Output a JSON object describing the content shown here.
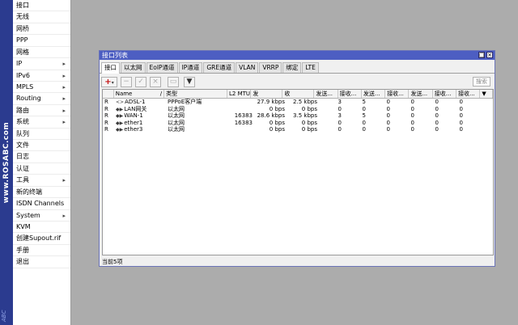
{
  "brand": {
    "text": "www.ROSABC.com",
    "sub": "ABC"
  },
  "menu": [
    {
      "label": "接口",
      "arrow": false
    },
    {
      "label": "无线",
      "arrow": false
    },
    {
      "label": "网桥",
      "arrow": false
    },
    {
      "label": "PPP",
      "arrow": false
    },
    {
      "label": "网格",
      "arrow": false
    },
    {
      "label": "IP",
      "arrow": true
    },
    {
      "label": "IPv6",
      "arrow": true
    },
    {
      "label": "MPLS",
      "arrow": true
    },
    {
      "label": "Routing",
      "arrow": true
    },
    {
      "label": "路由",
      "arrow": true
    },
    {
      "label": "系统",
      "arrow": true
    },
    {
      "label": "队列",
      "arrow": false
    },
    {
      "label": "文件",
      "arrow": false
    },
    {
      "label": "日志",
      "arrow": false
    },
    {
      "label": "认证",
      "arrow": false
    },
    {
      "label": "工具",
      "arrow": true
    },
    {
      "label": "新的终端",
      "arrow": false
    },
    {
      "label": "ISDN Channels",
      "arrow": false
    },
    {
      "label": "System",
      "arrow": true
    },
    {
      "label": "KVM",
      "arrow": false
    },
    {
      "label": "创建Supout.rif",
      "arrow": false
    },
    {
      "label": "手册",
      "arrow": false
    },
    {
      "label": "退出",
      "arrow": false
    }
  ],
  "window": {
    "title": "接口列表",
    "restore_glyph": "□",
    "close_glyph": "×",
    "tabs": [
      "接口",
      "以太网",
      "EoIP通道",
      "IP通道",
      "GRE通道",
      "VLAN",
      "VRRP",
      "绑定",
      "LTE"
    ],
    "toolbar": {
      "add": "+",
      "add_caret": "▾",
      "remove": "−",
      "enable": "✓",
      "disable": "×",
      "comment": "▭",
      "filter": "▼",
      "find": "搜索"
    },
    "columns": [
      "",
      "Name",
      "类型",
      "L2 MTU",
      "发",
      "收",
      "发送...",
      "接收...",
      "发送...",
      "接收...",
      "发送...",
      "接收...",
      "接收...",
      ""
    ],
    "header_sort": "/",
    "header_dropdown": "▼",
    "rows": [
      {
        "flag": "R",
        "icon": "<>",
        "name": "ADSL-1",
        "type": "PPPoE客户端",
        "mtu": "",
        "tx": "27.9 kbps",
        "rx": "2.5 kbps",
        "c1": "3",
        "c2": "5",
        "c3": "0",
        "c4": "0",
        "c5": "0",
        "c6": "0"
      },
      {
        "flag": "R",
        "icon": "◆▶",
        "name": "LAN网关",
        "type": "以太网",
        "mtu": "",
        "tx": "0 bps",
        "rx": "0 bps",
        "c1": "0",
        "c2": "0",
        "c3": "0",
        "c4": "0",
        "c5": "0",
        "c6": "0"
      },
      {
        "flag": "R",
        "icon": "◆▶",
        "name": "WAN-1",
        "type": "以太网",
        "mtu": "16383",
        "tx": "28.6 kbps",
        "rx": "3.5 kbps",
        "c1": "3",
        "c2": "5",
        "c3": "0",
        "c4": "0",
        "c5": "0",
        "c6": "0"
      },
      {
        "flag": "R",
        "icon": "◆▶",
        "name": "ether1",
        "type": "以太网",
        "mtu": "16383",
        "tx": "0 bps",
        "rx": "0 bps",
        "c1": "0",
        "c2": "0",
        "c3": "0",
        "c4": "0",
        "c5": "0",
        "c6": "0"
      },
      {
        "flag": "R",
        "icon": "◆▶",
        "name": "ether3",
        "type": "以太网",
        "mtu": "",
        "tx": "0 bps",
        "rx": "0 bps",
        "c1": "0",
        "c2": "0",
        "c3": "0",
        "c4": "0",
        "c5": "0",
        "c6": "0"
      }
    ],
    "status": "当前5项"
  }
}
